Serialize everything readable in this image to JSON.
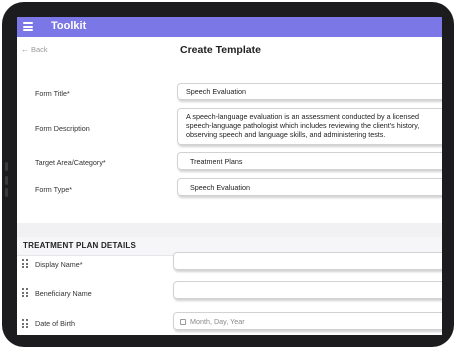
{
  "app": {
    "title": "Toolkit"
  },
  "nav": {
    "back_label": "Back",
    "page_title": "Create Template"
  },
  "form": {
    "title_label": "Form Title*",
    "title_value": "Speech Evaluation",
    "description_label": "Form Description",
    "description_value": "A speech-language evaluation is an assessment conducted by a licensed speech-language pathologist which includes reviewing the client's history, observing speech and language skills, and administering tests.",
    "category_label": "Target Area/Category*",
    "category_value": "Treatment Plans",
    "type_label": "Form Type*",
    "type_value": "Speech Evaluation"
  },
  "section": {
    "title": "TREATMENT PLAN DETAILS",
    "fields": [
      {
        "label": "Display Name*",
        "value": ""
      },
      {
        "label": "Beneficiary Name",
        "value": ""
      },
      {
        "label": "Date of Birth",
        "placeholder": "Month, Day, Year"
      }
    ]
  },
  "colors": {
    "topbar": "#7b77e6",
    "device": "#1c1c1e"
  },
  "icons": [
    "hamburger-icon",
    "back-arrow-icon",
    "drag-handle-icon",
    "calendar-icon"
  ]
}
